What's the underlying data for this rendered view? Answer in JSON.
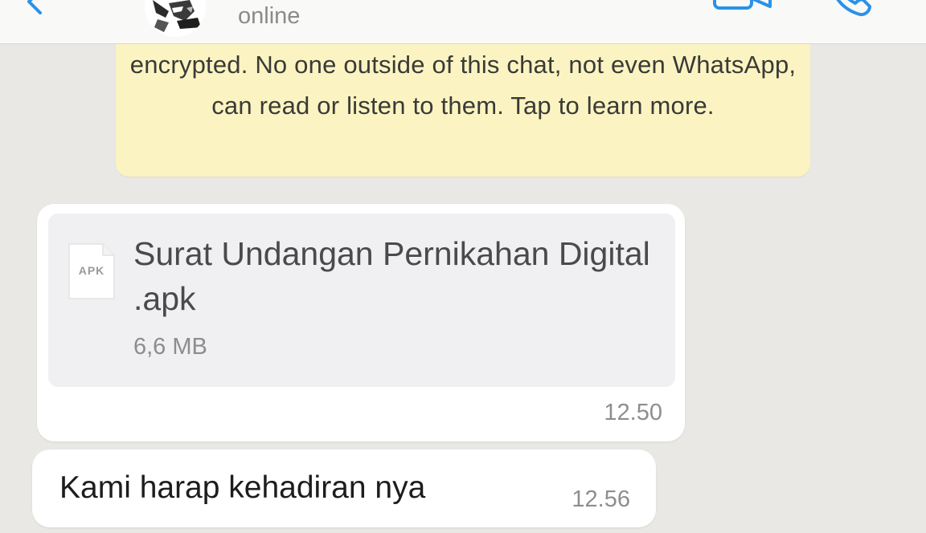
{
  "header": {
    "status": "online",
    "icons": {
      "back": "chevron-left-icon",
      "avatar": "avatar",
      "video": "video-camera-icon",
      "call": "phone-icon"
    },
    "accent_color": "#2a92e8"
  },
  "chat": {
    "encryption_notice": {
      "text": "encrypted. No one outside of this chat, not even WhatsApp, can read or listen to them. Tap to learn more."
    },
    "messages": [
      {
        "type": "file",
        "file_name": "Surat Undangan Pernikahan Digital .apk",
        "file_size": "6,6 MB",
        "file_type_label": "APK",
        "time": "12.50"
      },
      {
        "type": "text",
        "text": "Kami harap kehadiran nya",
        "time": "12.56"
      }
    ]
  }
}
